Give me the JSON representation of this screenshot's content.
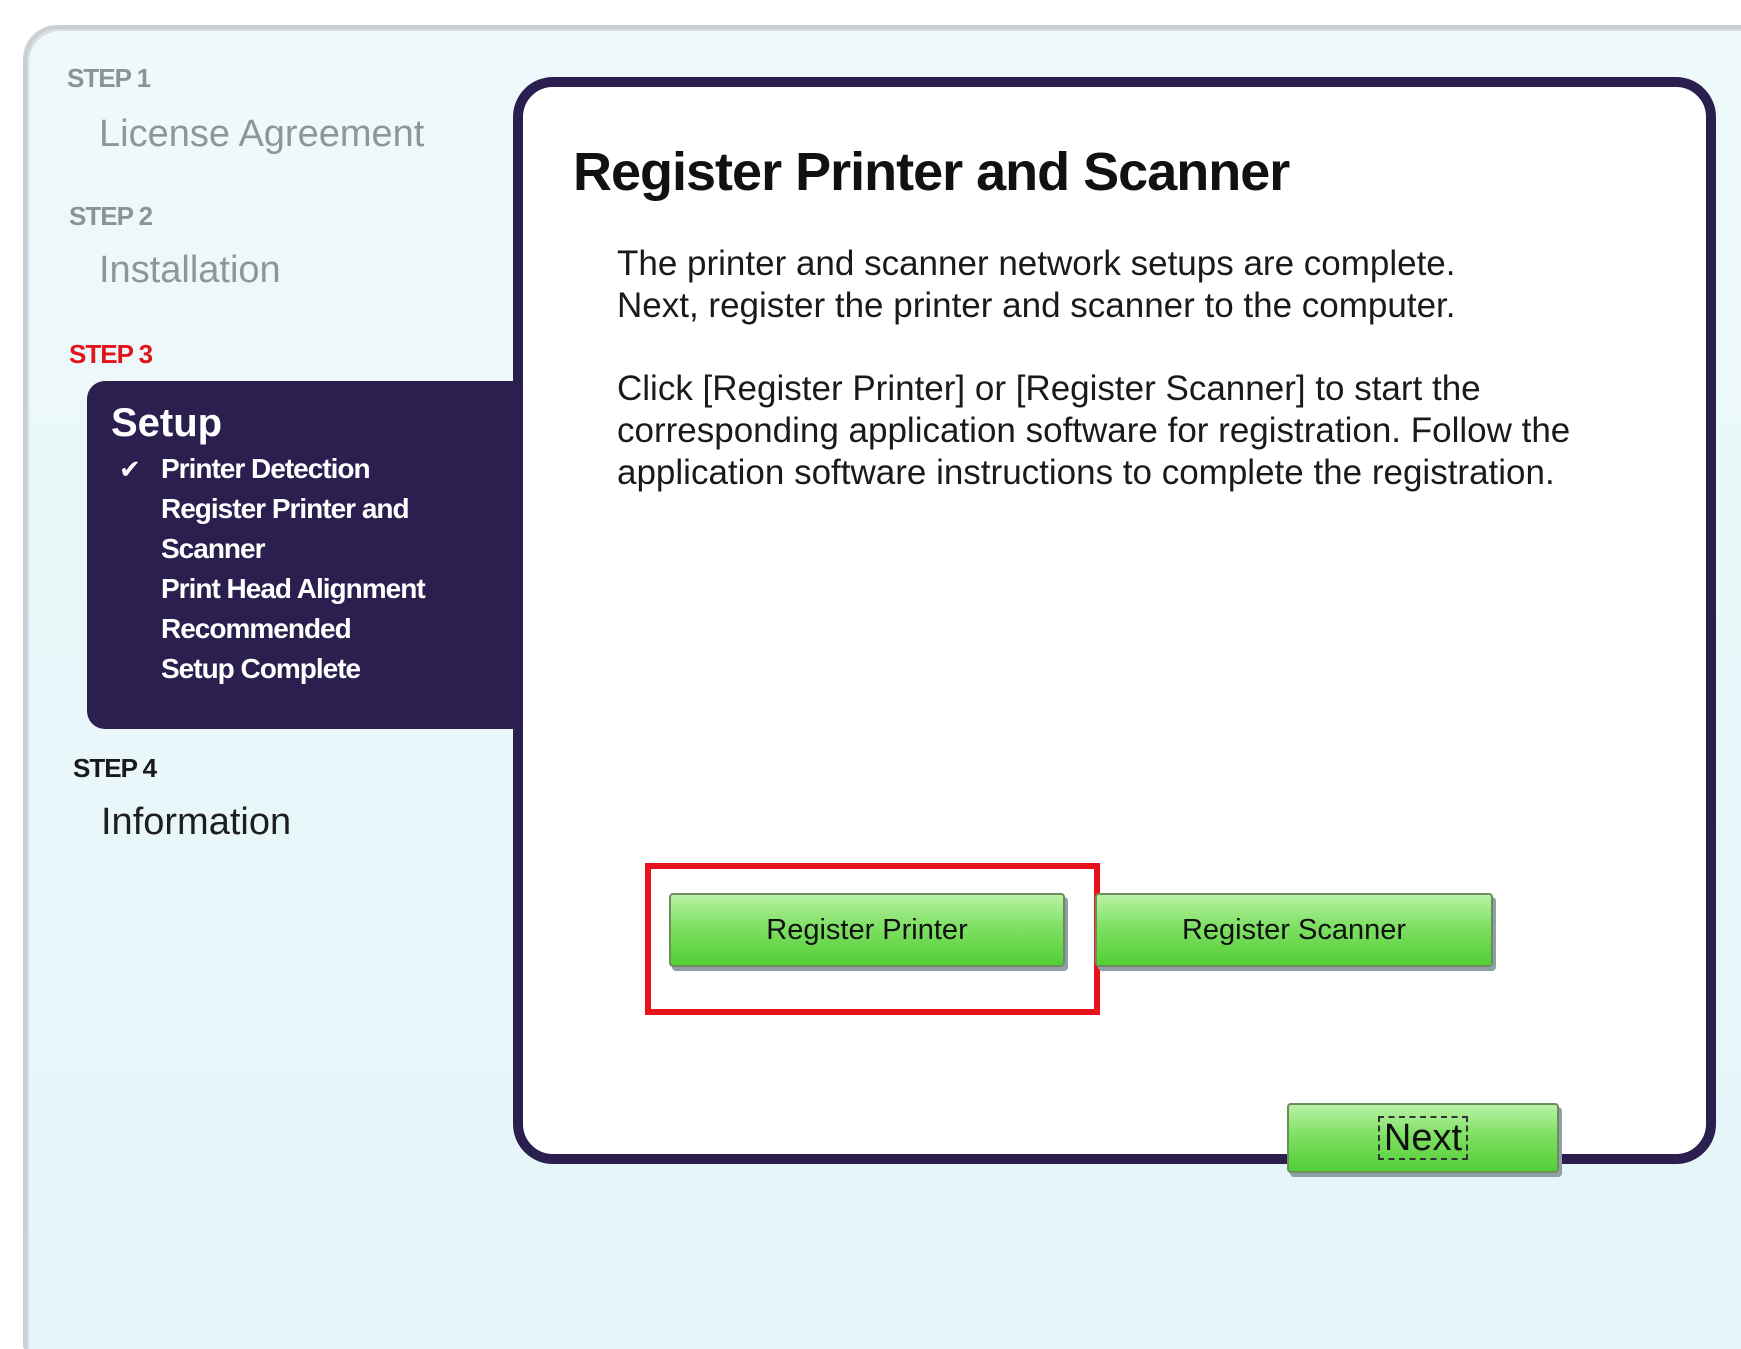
{
  "sidebar": {
    "steps": [
      {
        "label": "STEP 1",
        "title": "License Agreement",
        "state": "done"
      },
      {
        "label": "STEP 2",
        "title": "Installation",
        "state": "done"
      },
      {
        "label": "STEP 3",
        "title": "Setup",
        "state": "current",
        "substeps": [
          {
            "label": "Printer Detection",
            "checked": true
          },
          {
            "label": "Register Printer and",
            "checked": false
          },
          {
            "label": "Scanner",
            "checked": false
          },
          {
            "label": "Print Head Alignment",
            "checked": false
          },
          {
            "label": "Recommended",
            "checked": false
          },
          {
            "label": "Setup Complete",
            "checked": false
          }
        ]
      },
      {
        "label": "STEP 4",
        "title": "Information",
        "state": "pending"
      }
    ],
    "check_glyph": "✔"
  },
  "main": {
    "title": "Register Printer and Scanner",
    "paragraph1_line1": "The printer and scanner network setups are complete.",
    "paragraph1_line2": "Next, register the printer and scanner to the computer.",
    "paragraph2_line1": "Click [Register Printer] or [Register Scanner] to start the",
    "paragraph2_line2": "corresponding application software for registration. Follow the",
    "paragraph2_line3": "application software instructions to complete the registration.",
    "register_printer_label": "Register Printer",
    "register_scanner_label": "Register Scanner",
    "highlight_color": "#e8121c"
  },
  "footer": {
    "next_label": "Next"
  },
  "colors": {
    "panel_navy": "#2b1f4f",
    "current_step_red": "#e2141a",
    "button_green": "#52cf36",
    "window_background": "#eef9fb"
  }
}
